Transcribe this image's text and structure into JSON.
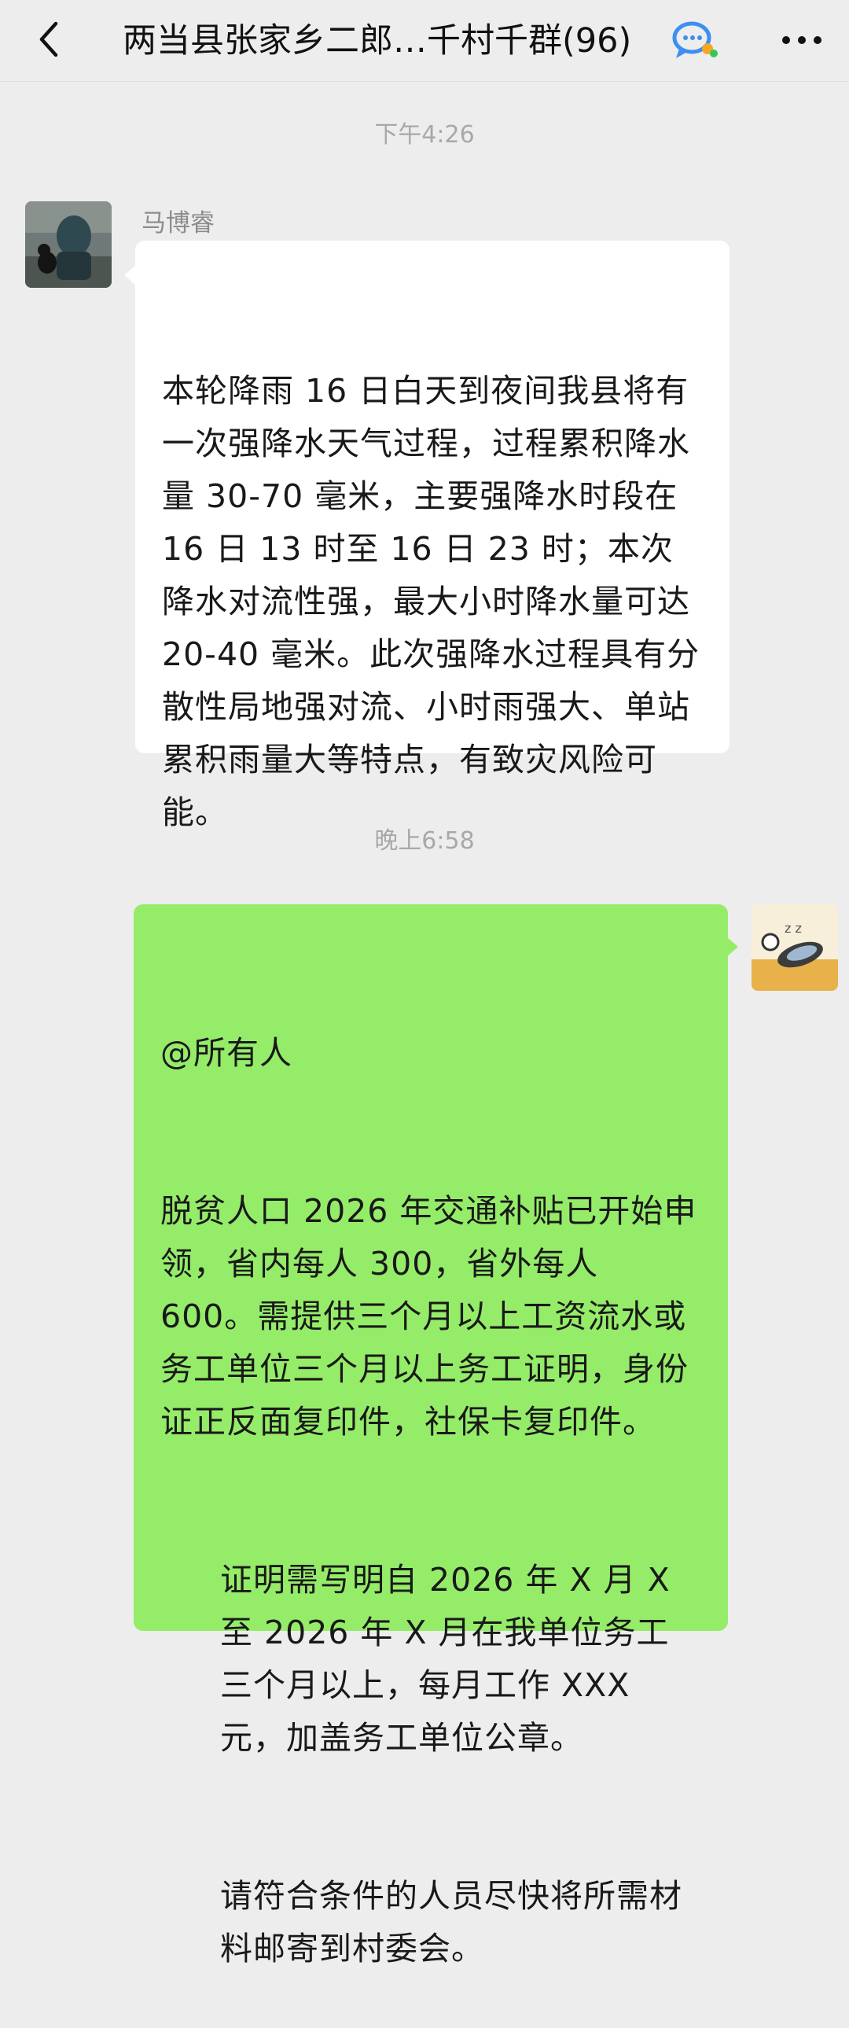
{
  "header": {
    "title": "两当县张家乡二郎…千村千群(96)",
    "back_icon": "chevron-left-icon",
    "more_icon": "more-dots-icon",
    "group_chat_icon": "group-chat-icon"
  },
  "messages": [
    {
      "timestamp": "下午4:26",
      "sender": "马博睿",
      "side": "left",
      "paragraphs": [
        "本轮降雨 16 日白天到夜间我县将有一次强降水天气过程，过程累积降水量 30-70 毫米，主要强降水时段在 16 日 13 时至 16 日 23 时；本次降水对流性强，最大小时降水量可达20-40 毫米。此次强降水过程具有分散性局地强对流、小时雨强大、单站累积雨量大等特点，有致灾风险可能。"
      ]
    },
    {
      "timestamp": "晚上6:58",
      "side": "right",
      "paragraphs": [
        "@所有人",
        "脱贫人口 2026 年交通补贴已开始申领，省内每人 300，省外每人 600。需提供三个月以上工资流水或务工单位三个月以上务工证明，身份证正反面复印件，社保卡复印件。",
        "证明需写明自 2026 年 X 月 X 至 2026 年 X 月在我单位务工三个月以上，每月工作 XXX 元，加盖务工单位公章。",
        "请符合条件的人员尽快将所需材料邮寄到村委会。"
      ]
    }
  ],
  "colors": {
    "background": "#ededed",
    "incoming_bubble": "#ffffff",
    "outgoing_bubble": "#95ec69",
    "timestamp_text": "#a8a8a8"
  }
}
